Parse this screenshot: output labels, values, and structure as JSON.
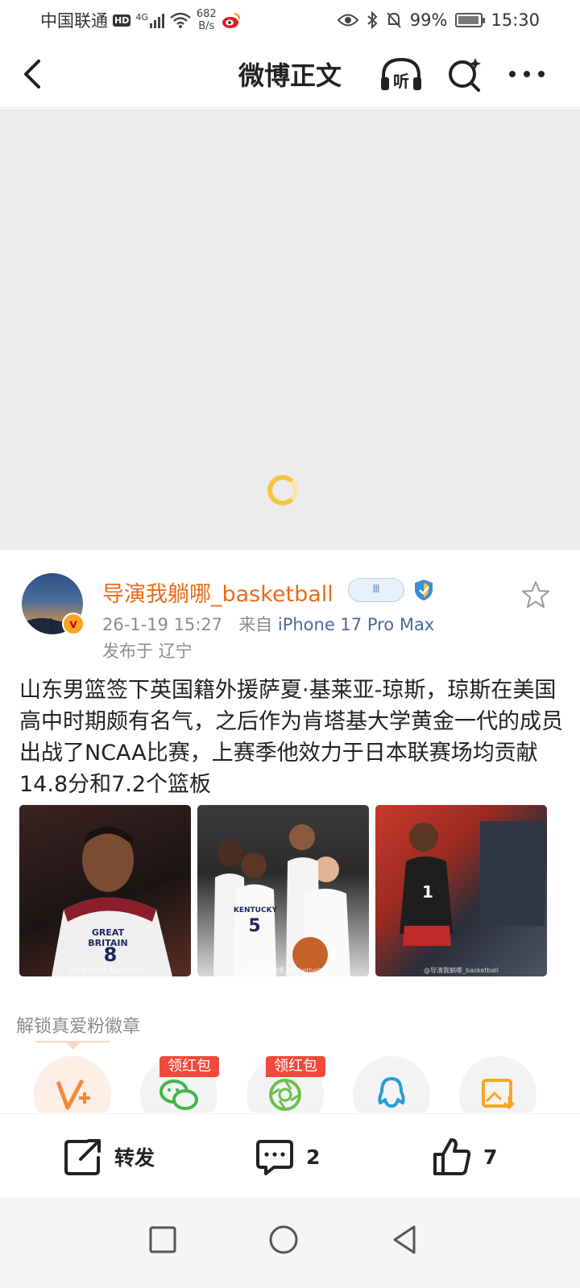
{
  "status_bar": {
    "carrier": "中国联通",
    "hd": "HD",
    "signal_gen": "4G",
    "net_speed_value": "682",
    "net_speed_unit": "B/s",
    "battery": "99%",
    "time": "15:30"
  },
  "nav": {
    "title": "微博正文",
    "listen_label": "听"
  },
  "post": {
    "username": "导演我躺哪_basketball",
    "member_badge": "Ⅲ",
    "timestamp": "26-1-19 15:27",
    "source_prefix": "来自",
    "source": "iPhone 17 Pro Max",
    "location": "发布于 辽宁",
    "text": "山东男篮签下英国籍外援萨夏·基莱亚-琼斯，琼斯在美国高中时期颇有名气，之后作为肯塔基大学黄金一代的成员出战了NCAA比赛，上赛季他效力于日本联赛场均贡献14.8分和7.2个篮板"
  },
  "images": {
    "img1_jersey": "GREAT BRITAIN",
    "img1_number": "8",
    "img2_jersey": "KENTUCKY",
    "img2_number": "5",
    "img3_number": "1",
    "watermark": "@导演我躺哪_basketball"
  },
  "unlock": {
    "label": "解锁真爱粉徽章"
  },
  "share": {
    "hongbao_1": "领红包",
    "hongbao_2": "领红包"
  },
  "actions": {
    "repost_label": "转发",
    "comment_count": "2",
    "like_count": "7"
  },
  "colors": {
    "username": "#e86c1a",
    "source_link": "#4a6b9a",
    "hongbao": "#f04a3a",
    "wechat": "#43b548",
    "moments": "#6cc04a",
    "qq": "#2a9bd7",
    "album": "#f5a623"
  }
}
